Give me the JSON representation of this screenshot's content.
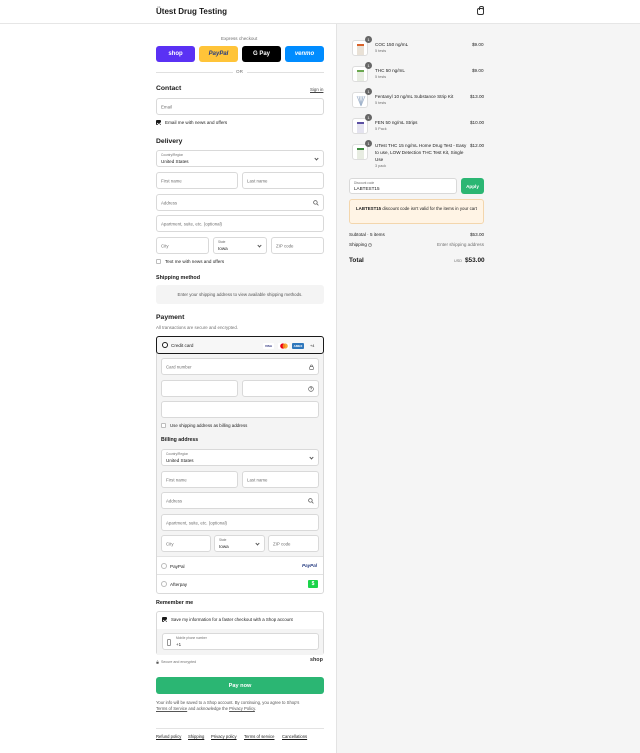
{
  "header": {
    "title": "Ütest Drug Testing",
    "cart_icon": "bag-icon"
  },
  "express": {
    "label": "Express checkout",
    "or": "OR",
    "buttons": [
      {
        "label": "shop",
        "color": "#5a31f4"
      },
      {
        "label": "PayPal",
        "color": "#ffc439"
      },
      {
        "label": "G Pay",
        "color": "#000000"
      },
      {
        "label": "venmo",
        "color": "#008cff"
      }
    ]
  },
  "contact": {
    "title": "Contact",
    "signin": "Sign in",
    "email_placeholder": "Email",
    "news_label": "Email me with news and offers",
    "news_checked": true
  },
  "delivery": {
    "title": "Delivery",
    "country_label": "Country/Region",
    "country_value": "United States",
    "first_name": "First name",
    "last_name": "Last name",
    "address": "Address",
    "apartment": "Apartment, suite, etc. (optional)",
    "city": "City",
    "state_label": "State",
    "state_value": "Iowa",
    "zip": "ZIP code",
    "text_label": "Text me with news and offers"
  },
  "shipping": {
    "title": "Shipping method",
    "message": "Enter your shipping address to view available shipping methods."
  },
  "payment": {
    "title": "Payment",
    "subtitle": "All transactions are secure and encrypted.",
    "credit_card": "Credit card",
    "card_brands": [
      "VISA",
      "MC",
      "AMEX"
    ],
    "more_cards": "+4",
    "card_number": "Card number",
    "use_shipping": "Use shipping address as billing address",
    "paypal": "PayPal",
    "afterpay": "Afterpay",
    "afterpay_logo": "$"
  },
  "billing": {
    "title": "Billing address",
    "country_label": "Country/Region",
    "country_value": "United States",
    "first_name": "First name",
    "last_name": "Last name",
    "address": "Address",
    "apartment": "Apartment, suite, etc. (optional)",
    "city": "City",
    "state_label": "State",
    "state_value": "Iowa",
    "zip": "ZIP code"
  },
  "remember": {
    "title": "Remember me",
    "save_label": "Save my information for a faster checkout with a Shop account",
    "phone_label": "Mobile phone number",
    "phone_value": "+1",
    "secure": "Secure and encrypted",
    "shop": "shop"
  },
  "pay": {
    "label": "Pay now",
    "note1": "Your info will be saved to a Shop account. By continuing, you agree to Shop's",
    "terms": "Terms of Service",
    "and": "and acknowledge the",
    "privacy": "Privacy Policy",
    "period": "."
  },
  "footer": [
    "Refund policy",
    "Shipping",
    "Privacy policy",
    "Terms of service",
    "Cancellations"
  ],
  "cart": {
    "items": [
      {
        "name": "COC 150 ng/mL",
        "variant": "5 tests",
        "qty": "1",
        "price": "$9.00"
      },
      {
        "name": "THC 50 ng/mL",
        "variant": "5 tests",
        "qty": "1",
        "price": "$9.00"
      },
      {
        "name": "Fentanyl 10 ng/mL Substance Strip Kit",
        "variant": "5 tests",
        "qty": "1",
        "price": "$13.00"
      },
      {
        "name": "FEN 50 ng/mL Strips",
        "variant": "5 Pack",
        "qty": "1",
        "price": "$10.00"
      },
      {
        "name": "UTest THC 15 ng/mL Home Drug Test - Easy to use, LOW Detection THC Test Kit, Single Use",
        "variant": "3 pack",
        "qty": "1",
        "price": "$12.00"
      }
    ],
    "discount_label": "Discount code",
    "discount_value": "LABTEST15",
    "apply": "Apply",
    "warning_code": "LABTEST15",
    "warning_text": "discount code isn't valid for the items in your cart",
    "subtotal_label": "Subtotal · 5 items",
    "subtotal": "$53.00",
    "shipping_label": "Shipping",
    "shipping_value": "Enter shipping address",
    "total_label": "Total",
    "currency": "USD",
    "total": "$53.00"
  },
  "colors": {
    "accent": "#2bb673",
    "warning_bg": "#fff4e5"
  }
}
